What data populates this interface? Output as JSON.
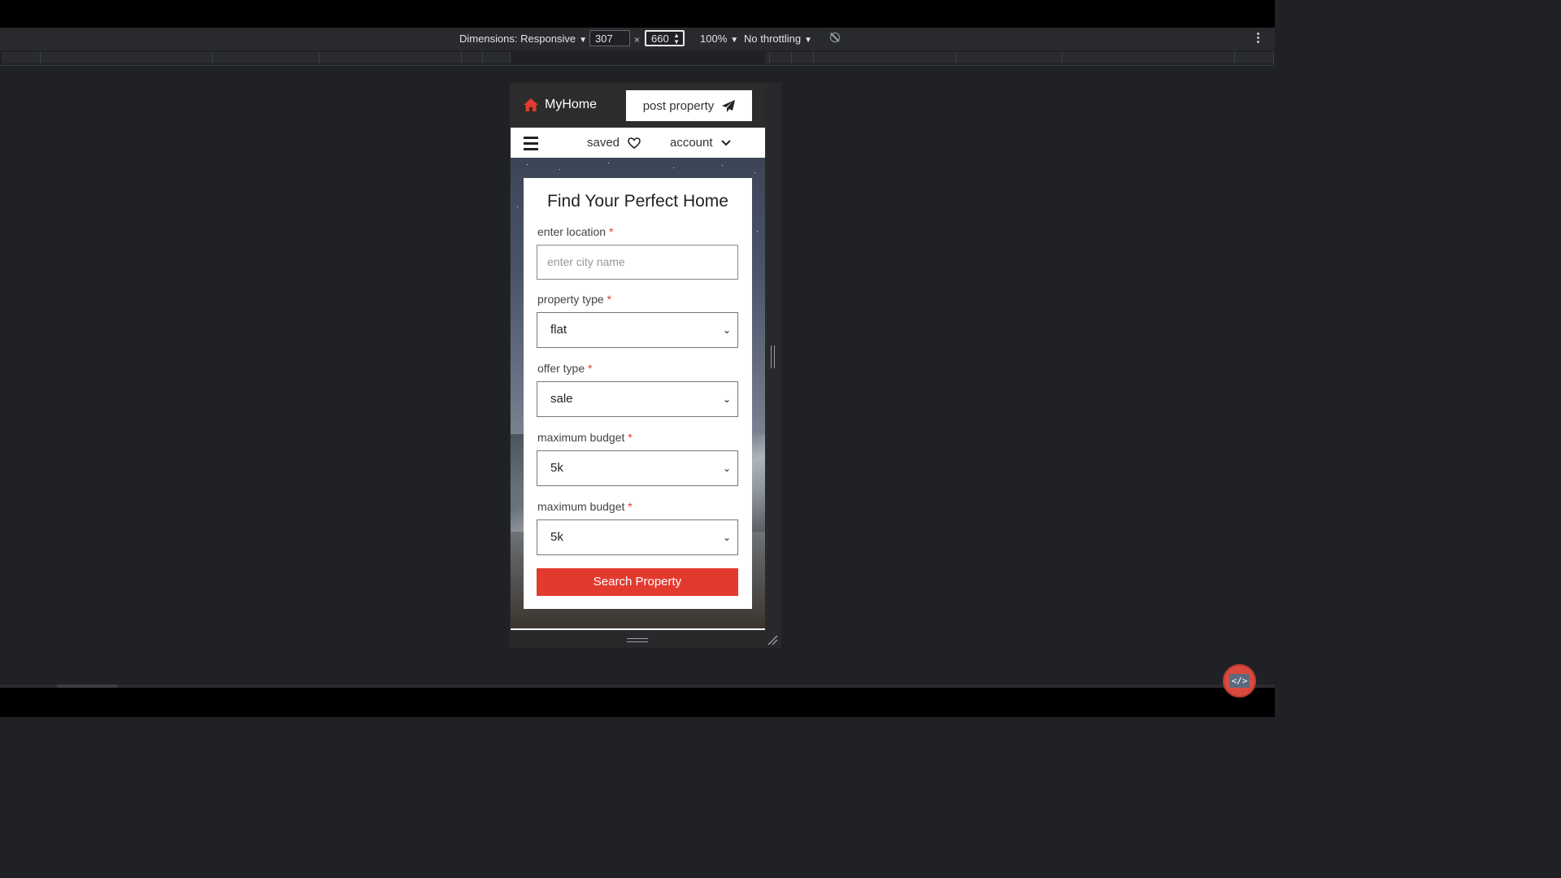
{
  "devtools": {
    "dimensions_label": "Dimensions: Responsive",
    "width": "307",
    "height": "660",
    "times": "×",
    "zoom": "100%",
    "throttling": "No throttling"
  },
  "header": {
    "brand": "MyHome",
    "post_button": "post property"
  },
  "nav": {
    "saved": "saved",
    "account": "account"
  },
  "form": {
    "title": "Find Your Perfect Home",
    "location_label": "enter location",
    "location_placeholder": "enter city name",
    "property_type_label": "property type",
    "property_type_value": "flat",
    "offer_type_label": "offer type",
    "offer_type_value": "sale",
    "budget1_label": "maximum budget",
    "budget1_value": "5k",
    "budget2_label": "maximum budget",
    "budget2_value": "5k",
    "required_mark": "*",
    "submit": "Search Property"
  },
  "fab": {
    "label": "</>"
  },
  "colors": {
    "accent": "#e23a2f",
    "header_bg": "#2c2c2c"
  }
}
